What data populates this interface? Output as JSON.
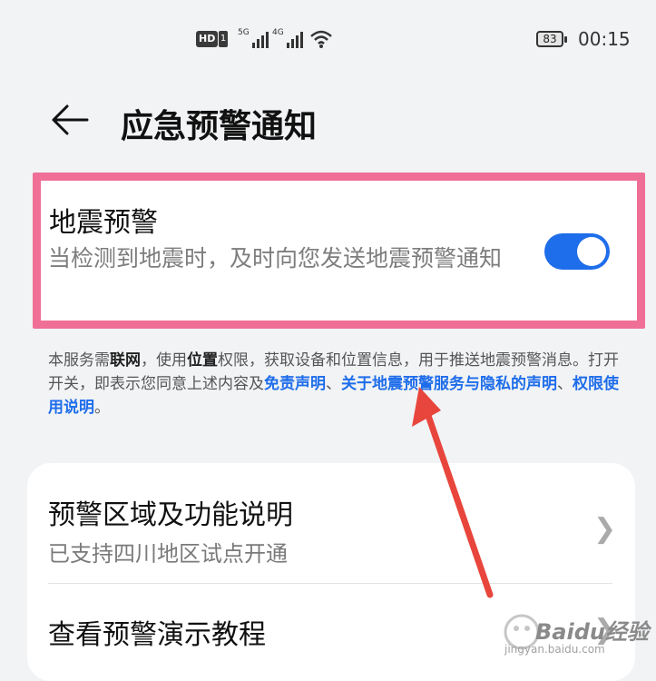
{
  "status_bar": {
    "hd_badge": "HD",
    "sim_badge": "1",
    "signal1_tag": "5G",
    "signal2_tag": "4G",
    "battery": "83",
    "time": "00:15"
  },
  "header": {
    "back_icon": "arrow-left-icon",
    "title": "应急预警通知"
  },
  "earthquake_card": {
    "title": "地震预警",
    "subtitle": "当检测到地震时，及时向您发送地震预警通知",
    "toggle_on": true,
    "toggle_color": "#1e6dea"
  },
  "note": {
    "p1": "本服务需",
    "b1": "联网",
    "p2": "，使用",
    "b2": "位置",
    "p3": "权限，获取设备和位置信息，用于推送地震预警消息。打开开关，即表示您同意上述内容及",
    "link1": "免责声明",
    "p4": "、",
    "link2": "关于地震预警服务与隐私的声明",
    "p5": "、",
    "link3": "权限使用说明",
    "p6": "。"
  },
  "settings_list": {
    "item1_title": "预警区域及功能说明",
    "item1_sub": "已支持四川地区试点开通",
    "item2_title": "查看预警演示教程",
    "chevron_icon": "chevron-right-icon"
  },
  "annotation": {
    "highlight_color": "#ef6f96",
    "arrow_color": "#e8453c"
  },
  "watermark": {
    "logo": "Baidu经验",
    "url": "jingyan.baidu.com"
  }
}
